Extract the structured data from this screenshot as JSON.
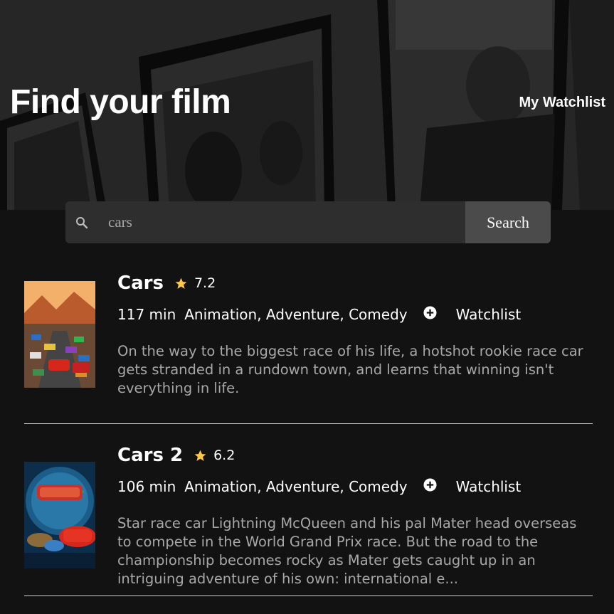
{
  "header": {
    "title": "Find your film",
    "watchlist_link": "My Watchlist"
  },
  "search": {
    "value": "cars",
    "button_label": "Search",
    "icon": "search-icon"
  },
  "accent_color": "#fec64a",
  "films": [
    {
      "title": "Cars",
      "rating": "7.2",
      "runtime": "117 min",
      "genres": "Animation, Adventure, Comedy",
      "watchlist_label": "Watchlist",
      "plot": "On the way to the biggest race of his life, a hotshot rookie race car gets stranded in a rundown town, and learns that winning isn't everything in life."
    },
    {
      "title": "Cars 2",
      "rating": "6.2",
      "runtime": "106 min",
      "genres": "Animation, Adventure, Comedy",
      "watchlist_label": "Watchlist",
      "plot": "Star race car Lightning McQueen and his pal Mater head overseas to compete in the World Grand Prix race. But the road to the championship becomes rocky as Mater gets caught up in an intriguing adventure of his own: international e..."
    }
  ]
}
